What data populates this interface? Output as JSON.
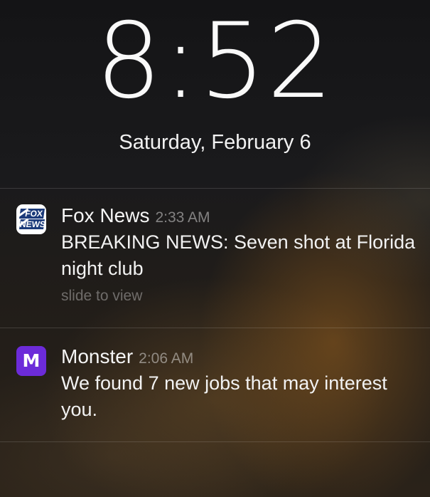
{
  "lockscreen": {
    "time": "8:52",
    "date": "Saturday, February 6"
  },
  "notifications": [
    {
      "app": "Fox News",
      "time": "2:33 AM",
      "message": "BREAKING NEWS: Seven shot at Florida night club",
      "hint": "slide to view",
      "icon": "fox-news-logo-icon",
      "icon_lines": [
        "FOX",
        "NEWS"
      ]
    },
    {
      "app": "Monster",
      "time": "2:06 AM",
      "message": "We found 7 new jobs that may interest you.",
      "icon": "monster-logo-icon",
      "icon_letter": "M",
      "icon_color": "#6c2bd9"
    }
  ]
}
